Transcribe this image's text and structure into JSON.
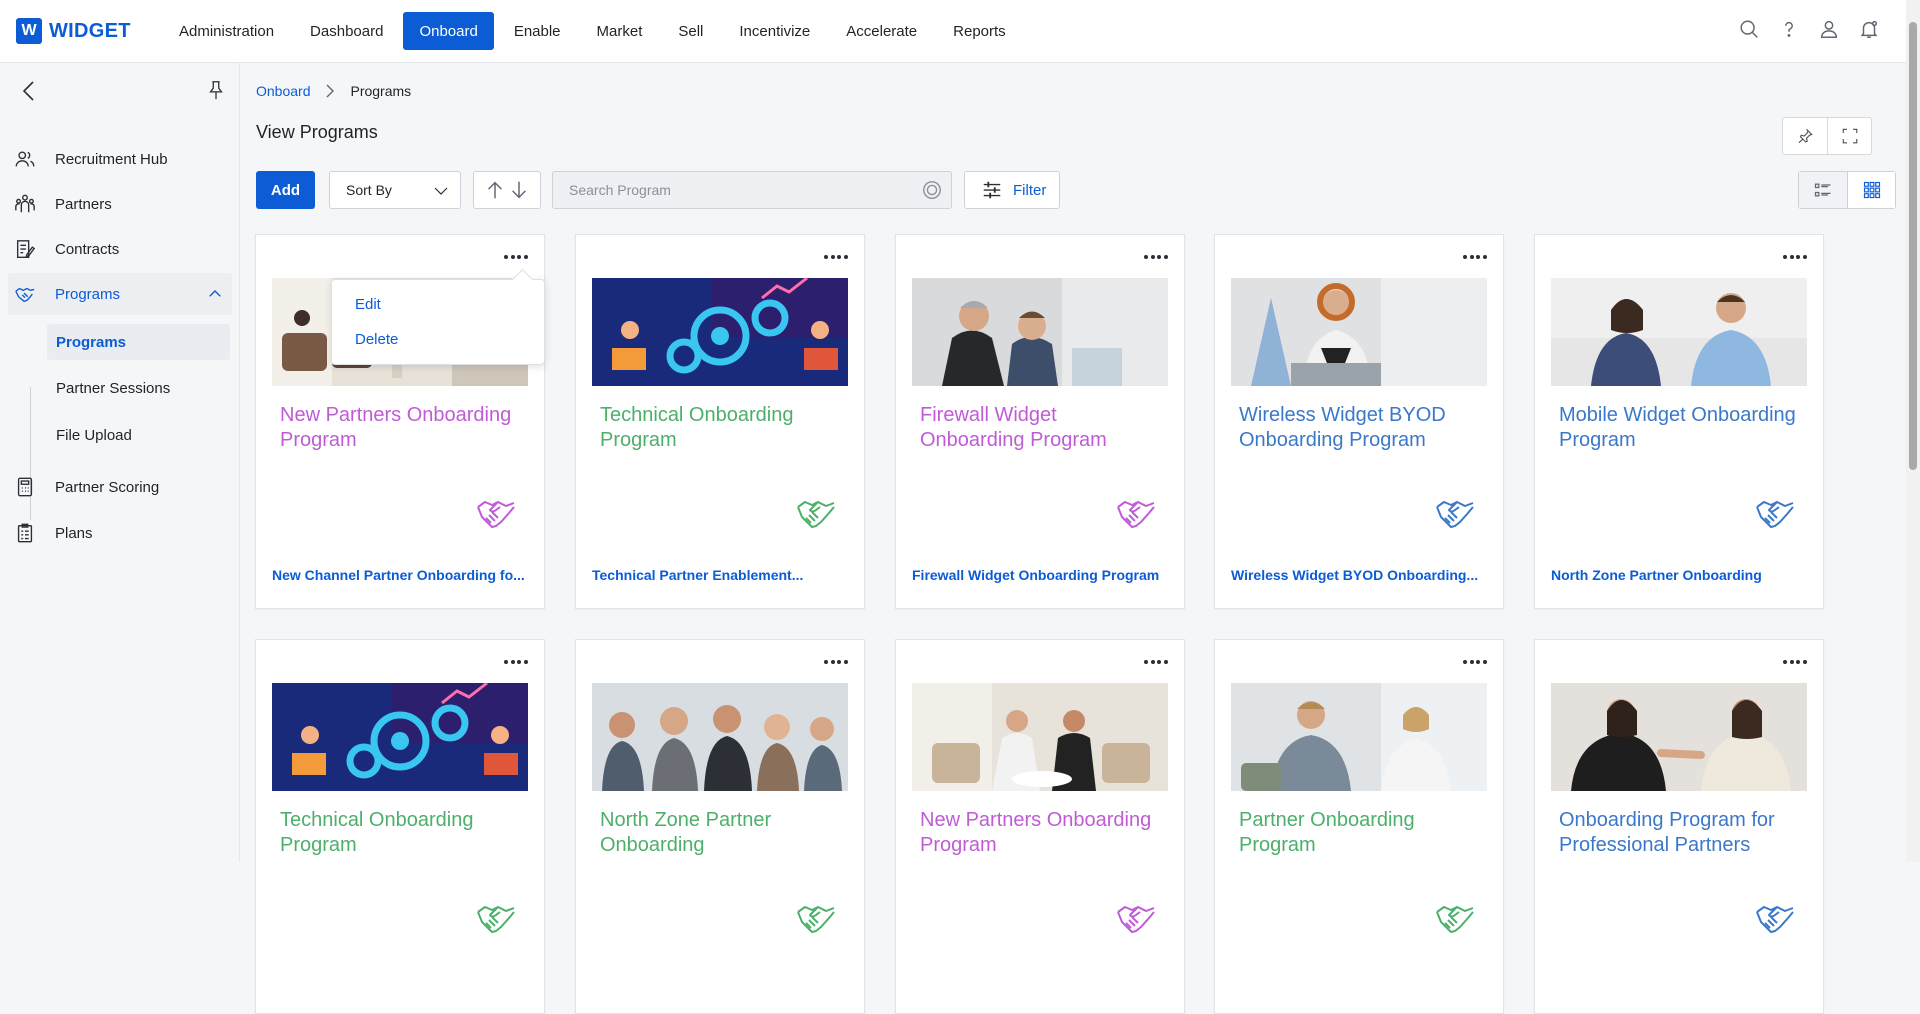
{
  "app": {
    "logo_letter": "W",
    "logo_text": "WIDGET"
  },
  "nav": {
    "items": [
      "Administration",
      "Dashboard",
      "Onboard",
      "Enable",
      "Market",
      "Sell",
      "Incentivize",
      "Accelerate",
      "Reports"
    ],
    "active": "Onboard"
  },
  "top_icons": [
    "search-icon",
    "help-icon",
    "user-icon",
    "bell-icon"
  ],
  "sidebar": {
    "items": [
      {
        "label": "Recruitment Hub",
        "icon": "people-icon"
      },
      {
        "label": "Partners",
        "icon": "partners-icon"
      },
      {
        "label": "Contracts",
        "icon": "contract-icon"
      },
      {
        "label": "Programs",
        "icon": "handshake-icon"
      },
      {
        "label": "Partner Scoring",
        "icon": "calculator-icon"
      },
      {
        "label": "Plans",
        "icon": "clipboard-icon"
      }
    ],
    "sub_items": [
      "Programs",
      "Partner Sessions",
      "File Upload"
    ],
    "active_sub": "Programs"
  },
  "breadcrumb": {
    "root": "Onboard",
    "current": "Programs"
  },
  "page_title": "View Programs",
  "toolbar": {
    "add_label": "Add",
    "sort_label": "Sort By",
    "search_placeholder": "Search Program",
    "filter_label": "Filter"
  },
  "context_menu": {
    "edit": "Edit",
    "delete": "Delete"
  },
  "colors": {
    "primary": "#0b5cd5",
    "pink": "#c05bd6",
    "green": "#4caf6a",
    "blue": "#3a78c9"
  },
  "cards": [
    {
      "title": "New Partners Onboarding Program",
      "subtitle": "New Channel Partner Onboarding fo...",
      "color": "#c05bd6",
      "image": "office-lounge"
    },
    {
      "title": "Technical Onboarding Program",
      "subtitle": "Technical Partner Enablement...",
      "color": "#4caf6a",
      "image": "gears-illustration"
    },
    {
      "title": "Firewall Widget Onboarding Program",
      "subtitle": "Firewall Widget Onboarding Program",
      "color": "#c05bd6",
      "image": "two-businessmen"
    },
    {
      "title": "Wireless Widget BYOD Onboarding Program",
      "subtitle": "Wireless Widget BYOD Onboarding...",
      "color": "#3a78c9",
      "image": "woman-laptop"
    },
    {
      "title": "Mobile Widget Onboarding Program",
      "subtitle": "North Zone Partner Onboarding",
      "color": "#3a78c9",
      "image": "two-colleagues"
    },
    {
      "title": "Technical Onboarding Program",
      "subtitle": "",
      "color": "#4caf6a",
      "image": "gears-illustration"
    },
    {
      "title": "North Zone Partner Onboarding",
      "subtitle": "",
      "color": "#4caf6a",
      "image": "team-cheering"
    },
    {
      "title": "New Partners Onboarding Program",
      "subtitle": "",
      "color": "#c05bd6",
      "image": "handshake-meeting"
    },
    {
      "title": "Partner Onboarding Program",
      "subtitle": "",
      "color": "#4caf6a",
      "image": "office-meeting"
    },
    {
      "title": "Onboarding Program for Professional Partners",
      "subtitle": "",
      "color": "#3a78c9",
      "image": "women-handshake"
    }
  ]
}
